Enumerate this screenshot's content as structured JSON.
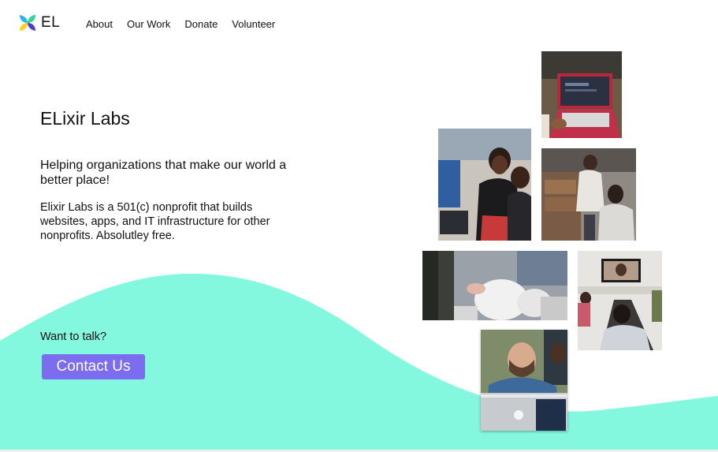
{
  "brand": {
    "name": "EL",
    "logo_icon": "elixir-leaf-logo-icon",
    "logo_colors": [
      "#ffd21a",
      "#27b4f0",
      "#4b3fc7",
      "#36d39a"
    ]
  },
  "nav": {
    "items": [
      {
        "label": "About"
      },
      {
        "label": "Our Work"
      },
      {
        "label": "Donate"
      },
      {
        "label": "Volunteer"
      }
    ]
  },
  "hero": {
    "title": "ELixir Labs",
    "tagline": "Helping organizations that make our world a better place!",
    "description": "Elixir Labs is a 501(c) nonprofit that builds websites, apps, and IT infrastructure for other nonprofits. Absolutley free."
  },
  "cta": {
    "prompt": "Want to talk?",
    "button_label": "Contact Us"
  },
  "colors": {
    "accent": "#7b6cf0",
    "wave": "#84f7df"
  },
  "photos": [
    {
      "subject": "laptop-photo"
    },
    {
      "subject": "students-at-computer-photo"
    },
    {
      "subject": "volunteers-packing-boxes-photo"
    },
    {
      "subject": "food-bags-packing-photo"
    },
    {
      "subject": "video-conference-room-photo"
    },
    {
      "subject": "developer-with-laptop-photo"
    }
  ]
}
